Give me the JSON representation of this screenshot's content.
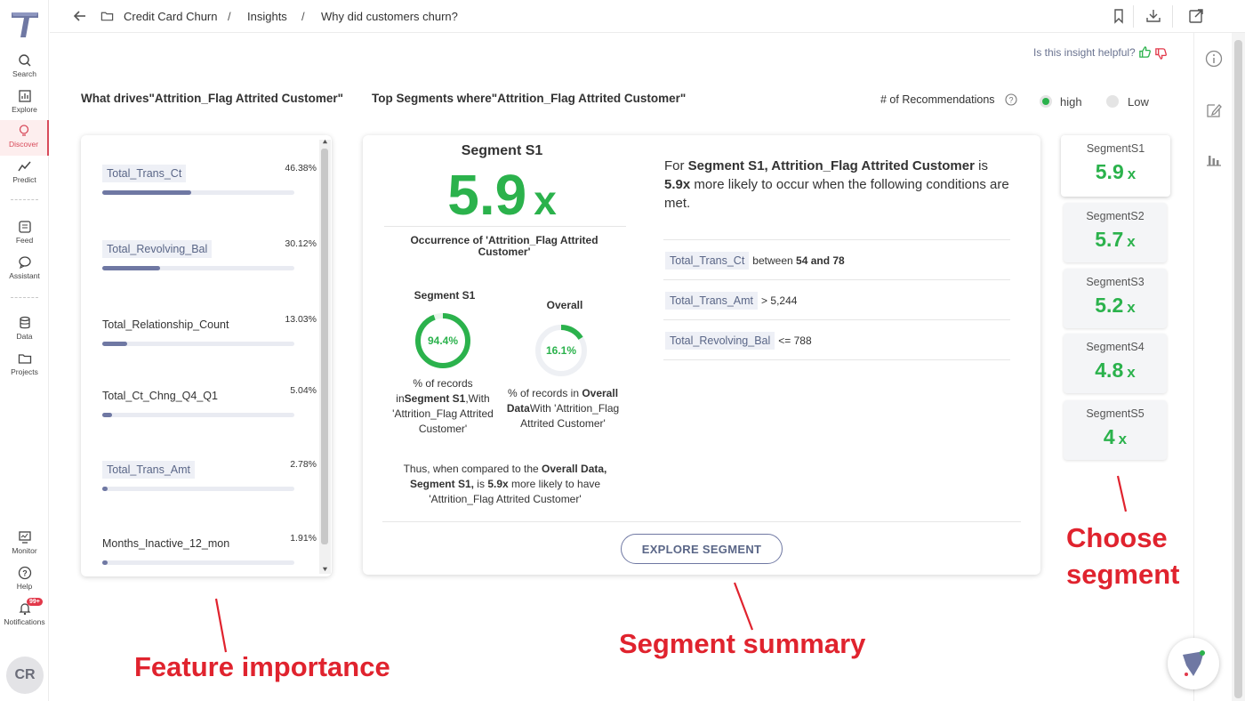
{
  "nav": {
    "items": [
      {
        "label": "Search",
        "icon": "search-icon"
      },
      {
        "label": "Explore",
        "icon": "chart-icon"
      },
      {
        "label": "Discover",
        "icon": "bulb-icon",
        "active": true
      },
      {
        "label": "Predict",
        "icon": "trend-icon"
      },
      {
        "label": "Feed",
        "icon": "feed-icon"
      },
      {
        "label": "Assistant",
        "icon": "chat-icon"
      },
      {
        "label": "Data",
        "icon": "database-icon"
      },
      {
        "label": "Projects",
        "icon": "folder-icon"
      },
      {
        "label": "Monitor",
        "icon": "monitor-icon"
      },
      {
        "label": "Help",
        "icon": "help-icon"
      },
      {
        "label": "Notifications",
        "icon": "bell-icon",
        "badge": "99+"
      }
    ],
    "avatar": "CR"
  },
  "breadcrumb": {
    "project": "Credit Card Churn",
    "section": "Insights",
    "page": "Why did customers churn?",
    "sep": "/"
  },
  "helpful": {
    "label": "Is this insight helpful?"
  },
  "headings": {
    "drivers": "What drives\"Attrition_Flag Attrited Customer\"",
    "segments": "Top Segments where\"Attrition_Flag Attrited Customer\""
  },
  "recommendations": {
    "label": "# of Recommendations",
    "options": [
      "high",
      "Low"
    ],
    "selected": "high"
  },
  "feature_importance": [
    {
      "name": "Total_Trans_Ct",
      "pct": "46.38%",
      "value": 46.38,
      "tag": true
    },
    {
      "name": "Total_Revolving_Bal",
      "pct": "30.12%",
      "value": 30.12,
      "tag": true
    },
    {
      "name": "Total_Relationship_Count",
      "pct": "13.03%",
      "value": 13.03,
      "tag": false
    },
    {
      "name": "Total_Ct_Chng_Q4_Q1",
      "pct": "5.04%",
      "value": 5.04,
      "tag": false
    },
    {
      "name": "Total_Trans_Amt",
      "pct": "2.78%",
      "value": 2.78,
      "tag": true
    },
    {
      "name": "Months_Inactive_12_mon",
      "pct": "1.91%",
      "value": 1.91,
      "tag": false
    }
  ],
  "segment": {
    "title": "Segment S1",
    "ratio": "5.9",
    "x": "x",
    "occurrence_label": "Occurrence of 'Attrition_Flag Attrited Customer'",
    "segment_donut": {
      "title": "Segment S1",
      "pct_label": "94.4%",
      "value": 0.944,
      "cap_pre": "% of records in",
      "cap_bold": "Segment S1",
      "cap_post": ",With 'Attrition_Flag Attrited Customer'"
    },
    "overall_donut": {
      "title": "Overall",
      "pct_label": "16.1%",
      "value": 0.161,
      "cap_pre": "% of records in ",
      "cap_bold": "Overall Data",
      "cap_post": "With 'Attrition_Flag Attrited Customer'"
    },
    "thus": {
      "p1": "Thus, when compared to the ",
      "b1": "Overall Data, Segment S1,",
      "p2": " is ",
      "b2": "5.9x",
      "p3": " more likely to have 'Attrition_Flag Attrited Customer'"
    },
    "desc": {
      "p1": "For ",
      "b1": "Segment S1, Attrition_Flag Attrited Customer",
      "p2": " is ",
      "b2": "5.9x",
      "p3": " more likely to occur when the following conditions are met."
    },
    "conditions": [
      {
        "feature": "Total_Trans_Ct",
        "op": "between",
        "value": "54 and 78"
      },
      {
        "feature": "Total_Trans_Amt",
        "op": ">",
        "value": "5,244"
      },
      {
        "feature": "Total_Revolving_Bal",
        "op": "<=",
        "value": "788"
      }
    ],
    "explore_button": "EXPLORE SEGMENT"
  },
  "segment_list": [
    {
      "name": "SegmentS1",
      "ratio": "5.9",
      "active": true
    },
    {
      "name": "SegmentS2",
      "ratio": "5.7"
    },
    {
      "name": "SegmentS3",
      "ratio": "5.2"
    },
    {
      "name": "SegmentS4",
      "ratio": "4.8"
    },
    {
      "name": "SegmentS5",
      "ratio": "4"
    }
  ],
  "annotations": {
    "feature": "Feature importance",
    "summary": "Segment summary",
    "choose": "Choose segment"
  },
  "colors": {
    "accent": "#2bb24c",
    "bar": "#6f78a3",
    "annotation": "#e0232e",
    "active_nav": "#d84a5a"
  }
}
